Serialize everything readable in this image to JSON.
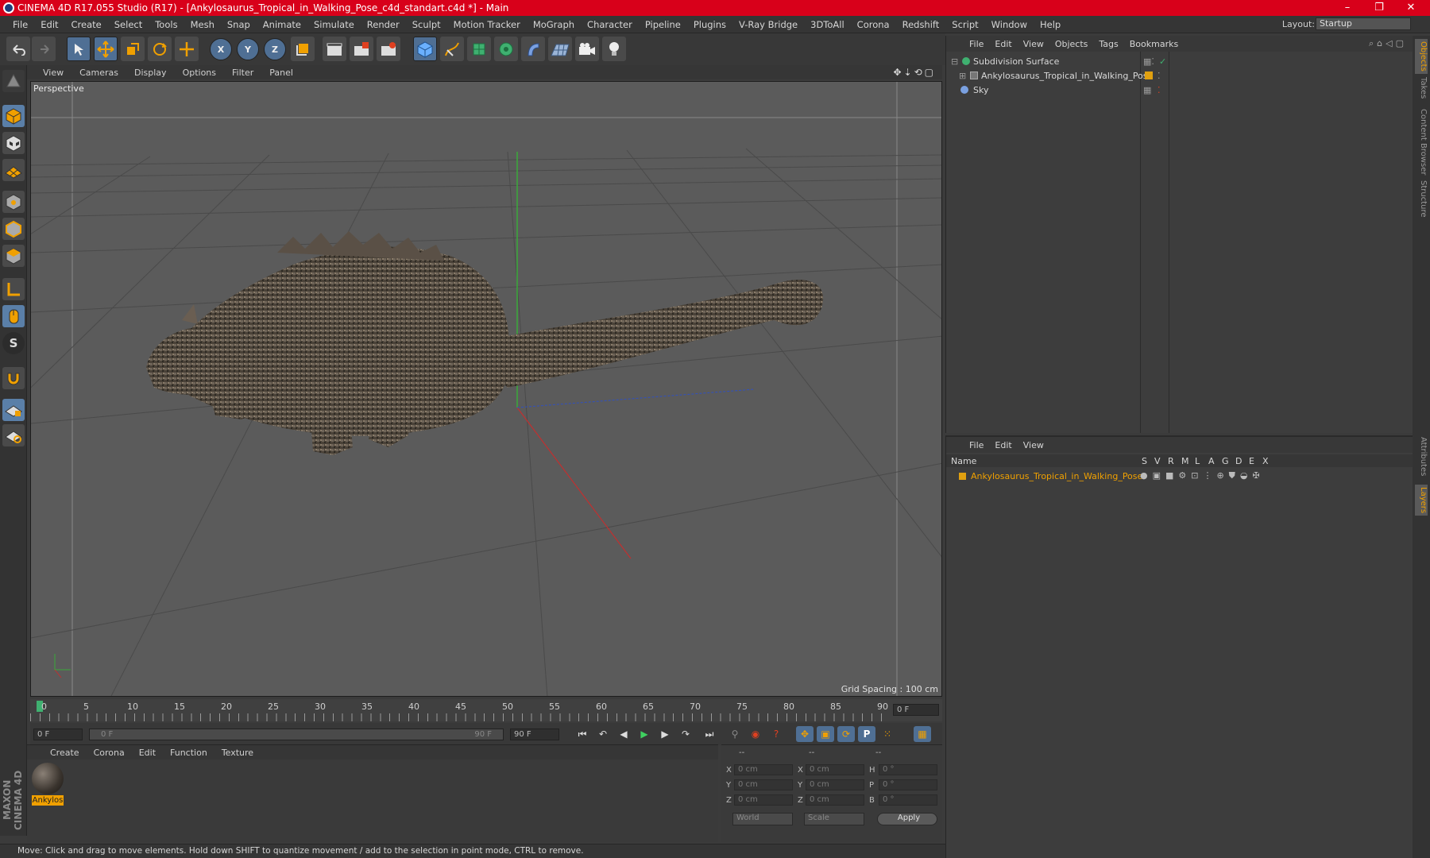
{
  "window": {
    "title": "CINEMA 4D R17.055 Studio (R17) - [Ankylosaurus_Tropical_in_Walking_Pose_c4d_standart.c4d *] - Main",
    "minimize": "–",
    "maximize": "❐",
    "close": "✕"
  },
  "menubar": {
    "items": [
      "File",
      "Edit",
      "Create",
      "Select",
      "Tools",
      "Mesh",
      "Snap",
      "Animate",
      "Simulate",
      "Render",
      "Sculpt",
      "Motion Tracker",
      "MoGraph",
      "Character",
      "Pipeline",
      "Plugins",
      "V-Ray Bridge",
      "3DToAll",
      "Corona",
      "Redshift",
      "Script",
      "Window",
      "Help"
    ],
    "layout_label": "Layout:",
    "layout_value": "Startup"
  },
  "toolbar": {
    "axis_x": "X",
    "axis_y": "Y",
    "axis_z": "Z"
  },
  "lefttools": {
    "sculpt_label": "S"
  },
  "viewport": {
    "menu": [
      "View",
      "Cameras",
      "Display",
      "Options",
      "Filter",
      "Panel"
    ],
    "label": "Perspective",
    "grid_spacing": "Grid Spacing : 100 cm"
  },
  "timeline": {
    "ticks": [
      "0",
      "5",
      "10",
      "15",
      "20",
      "25",
      "30",
      "35",
      "40",
      "45",
      "50",
      "55",
      "60",
      "65",
      "70",
      "75",
      "80",
      "85",
      "90"
    ],
    "current_frame": "0 F",
    "start_field": "0 F",
    "range_start": "0 F",
    "range_end": "90 F",
    "end_field": "90 F"
  },
  "material_panel": {
    "menu": [
      "Create",
      "Corona",
      "Edit",
      "Function",
      "Texture"
    ],
    "material_name": "Ankylos"
  },
  "coords_panel": {
    "header_dashes": [
      "--",
      "--",
      "--"
    ],
    "labels": [
      "X",
      "Y",
      "Z",
      "X",
      "Y",
      "Z",
      "H",
      "P",
      "B"
    ],
    "pos_x": "0 cm",
    "pos_y": "0 cm",
    "pos_z": "0 cm",
    "size_x": "0 cm",
    "size_y": "0 cm",
    "size_z": "0 cm",
    "rot_h": "0 °",
    "rot_p": "0 °",
    "rot_b": "0 °",
    "world_select": "World",
    "scale_select": "Scale",
    "apply_button": "Apply"
  },
  "statusbar": {
    "text": "Move: Click and drag to move elements. Hold down SHIFT to quantize movement / add to the selection in point mode, CTRL to remove."
  },
  "objects_panel": {
    "menu": [
      "File",
      "Edit",
      "View",
      "Objects",
      "Tags",
      "Bookmarks"
    ],
    "rows": [
      {
        "name": "Subdivision Surface"
      },
      {
        "name": "Ankylosaurus_Tropical_in_Walking_Pose"
      },
      {
        "name": "Sky"
      }
    ]
  },
  "layers_panel": {
    "menu": [
      "File",
      "Edit",
      "View"
    ],
    "header_name": "Name",
    "columns": [
      "S",
      "V",
      "R",
      "M",
      "L",
      "A",
      "G",
      "D",
      "E",
      "X"
    ],
    "rows": [
      {
        "name": "Ankylosaurus_Tropical_in_Walking_Pose"
      }
    ]
  },
  "side_tabs": {
    "top": [
      "Objects",
      "Takes",
      "Content Browser",
      "Structure"
    ],
    "bottom": [
      "Attributes",
      "Layers"
    ]
  },
  "brand": {
    "maxon_logo": "MAXON CINEMA 4D"
  },
  "colors": {
    "title_bar": "#d8001a",
    "accent_orange": "#f0a000",
    "highlight_blue": "#4f6f94",
    "layer_color": "#e0a010"
  }
}
